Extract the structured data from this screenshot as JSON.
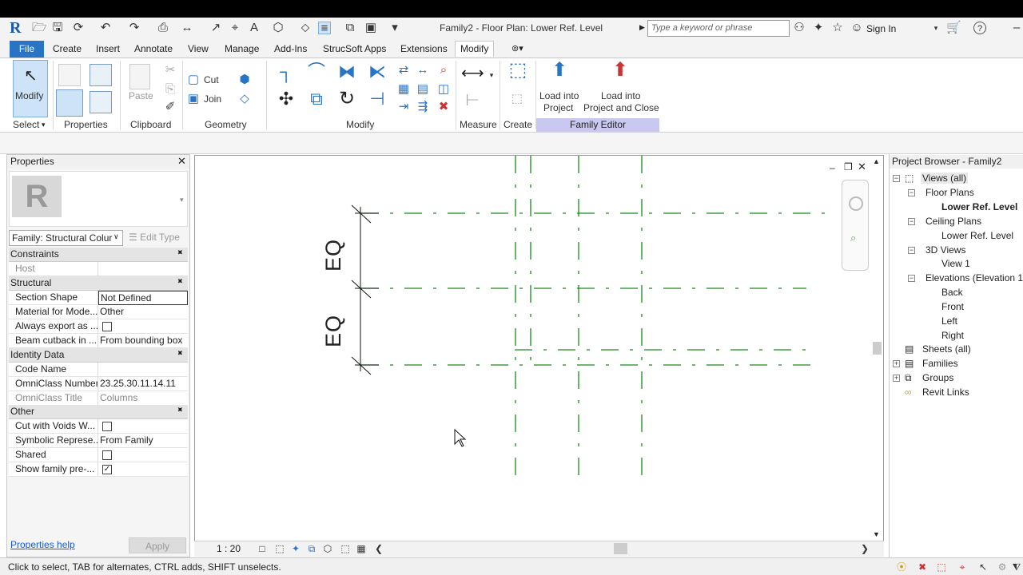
{
  "window": {
    "title": "Family2 - Floor Plan: Lower Ref. Level",
    "search_placeholder": "Type a keyword or phrase",
    "sign_in": "Sign In"
  },
  "ribbon_tabs": [
    "File",
    "Create",
    "Insert",
    "Annotate",
    "View",
    "Manage",
    "Add-Ins",
    "StrucSoft Apps",
    "Extensions",
    "Modify"
  ],
  "ribbon": {
    "modify_label": "Modify",
    "paste_label": "Paste",
    "cut_label": "Cut",
    "join_label": "Join",
    "load_into_project": [
      "Load into",
      "Project"
    ],
    "load_into_project_close": [
      "Load into",
      "Project and Close"
    ],
    "panels": {
      "select": "Select",
      "properties": "Properties",
      "clipboard": "Clipboard",
      "geometry": "Geometry",
      "modify": "Modify",
      "measure": "Measure",
      "create": "Create",
      "family_editor": "Family Editor"
    }
  },
  "properties": {
    "title": "Properties",
    "family_select": "Family: Structural Colur",
    "edit_type": "Edit Type",
    "groups": {
      "constraints": "Constraints",
      "structural": "Structural",
      "identity": "Identity Data",
      "other": "Other"
    },
    "rows": {
      "host": {
        "k": "Host",
        "v": ""
      },
      "section_shape": {
        "k": "Section Shape",
        "v": "Not Defined"
      },
      "material": {
        "k": "Material for Mode...",
        "v": "Other"
      },
      "always_export": {
        "k": "Always export as ...",
        "v": ""
      },
      "beam_cutback": {
        "k": "Beam cutback in ...",
        "v": "From bounding box"
      },
      "code_name": {
        "k": "Code Name",
        "v": ""
      },
      "omniclass_number": {
        "k": "OmniClass Number",
        "v": "23.25.30.11.14.11"
      },
      "omniclass_title": {
        "k": "OmniClass Title",
        "v": "Columns"
      },
      "cut_voids": {
        "k": "Cut with Voids W...",
        "v": ""
      },
      "symbolic": {
        "k": "Symbolic Represe...",
        "v": "From Family"
      },
      "shared": {
        "k": "Shared",
        "v": ""
      },
      "show_family": {
        "k": "Show family pre-...",
        "v": ""
      }
    },
    "help": "Properties help",
    "apply": "Apply"
  },
  "canvas": {
    "dim_top": "EQ",
    "dim_bottom": "EQ",
    "scale": "1 : 20"
  },
  "browser": {
    "title": "Project Browser - Family2",
    "views_all": "Views (all)",
    "floor_plans": "Floor Plans",
    "lower_ref_level_fp": "Lower Ref. Level",
    "ceiling_plans": "Ceiling Plans",
    "lower_ref_level_cp": "Lower Ref. Level",
    "views_3d": "3D Views",
    "view1": "View 1",
    "elevations": "Elevations (Elevation 1)",
    "back": "Back",
    "front": "Front",
    "left": "Left",
    "right": "Right",
    "sheets": "Sheets (all)",
    "families": "Families",
    "groups": "Groups",
    "revit_links": "Revit Links"
  },
  "status": "Click to select, TAB for alternates, CTRL adds, SHIFT unselects.",
  "colors": {
    "ref_line": "#1a8a1a",
    "accent": "#2a74c6",
    "family_editor": "#c8c8f0"
  }
}
